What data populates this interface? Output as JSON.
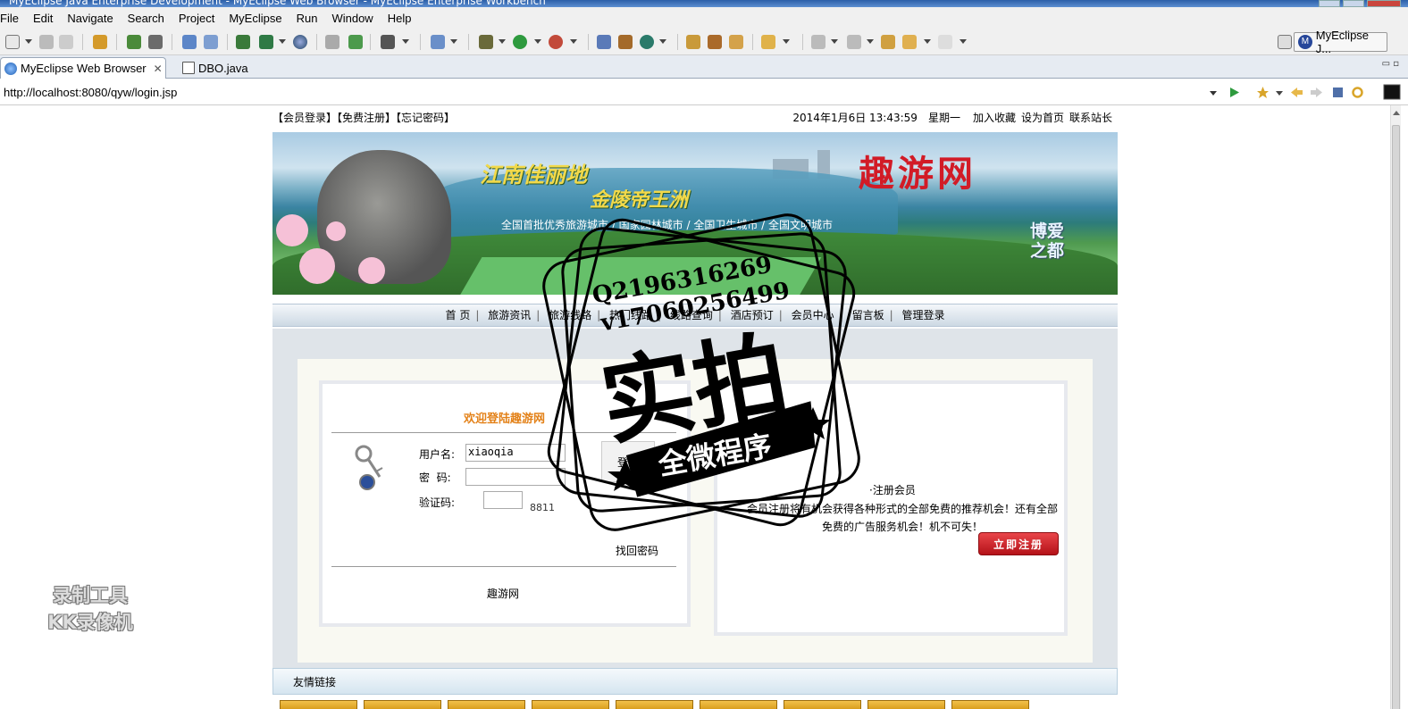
{
  "window": {
    "title": "MyEclipse Java Enterprise Development - MyEclipse Web Browser - MyEclipse Enterprise Workbench"
  },
  "menu": [
    "File",
    "Edit",
    "Navigate",
    "Search",
    "Project",
    "MyEclipse",
    "Run",
    "Window",
    "Help"
  ],
  "perspective": {
    "label": "MyEclipse J..."
  },
  "tabs": [
    {
      "label": "MyEclipse Web Browser",
      "close": "✕"
    },
    {
      "label": "DBO.java"
    }
  ],
  "address": {
    "url": "http://localhost:8080/qyw/login.jsp"
  },
  "site": {
    "top_links": "【会员登录】【免费注册】【忘记密码】",
    "datetime": "2014年1月6日 13:43:59",
    "weekday": "星期一",
    "utility_links": [
      "加入收藏",
      "设为首页",
      "联系站长"
    ],
    "banner": {
      "line1": "江南佳丽地",
      "line2": "金陵帝王洲",
      "line3": "全国首批优秀旅游城市 / 国家园林城市 / 全国卫生城市 / 全国文明城市",
      "brand": "趣游网",
      "slogan1": "博爱",
      "slogan2": "之都"
    },
    "nav": [
      "首 页",
      "旅游资讯",
      "旅游线路",
      "热门线路",
      "线路查询",
      "酒店预订",
      "会员中心",
      "留言板",
      "管理登录"
    ],
    "login": {
      "welcome": "欢迎登陆趣游网",
      "username_label": "用户名:",
      "username_value": "xiaoqia",
      "password_label": "密  码:",
      "captcha_label": "验证码:",
      "captcha_code": "8811",
      "login_button": "登录",
      "find_password": "找回密码",
      "footer": "趣游网"
    },
    "register": {
      "title": "·注册会员",
      "desc": "会员注册将有机会获得各种形式的全部免费的推荐机会！还有全部免费的广告服务机会！机不可失！",
      "button": "立即注册"
    },
    "friends": {
      "label": "友情链接"
    }
  },
  "overlays": {
    "watermark": {
      "qq": "Q2196316269",
      "v": "v17060256499",
      "main": "实拍",
      "tag": "全微程序"
    },
    "recorder": {
      "line1": "录制工具",
      "line2": "KK录像机"
    }
  }
}
